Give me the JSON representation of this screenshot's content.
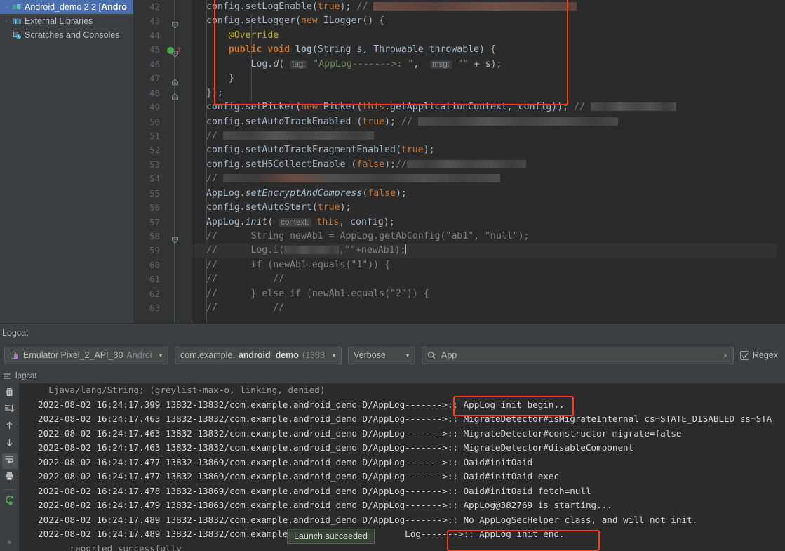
{
  "project_tree": {
    "items": [
      {
        "arrow": "›",
        "icon": "module-icon",
        "label": "Android_demo 2 2 [Andro",
        "bold_from": 18,
        "selected": true
      },
      {
        "arrow": "›",
        "icon": "external-libraries-icon",
        "label": "External Libraries",
        "selected": false
      },
      {
        "arrow": "",
        "icon": "scratches-icon",
        "label": "Scratches and Consoles",
        "selected": false
      }
    ]
  },
  "editor": {
    "lines": [
      {
        "num": "42",
        "fold": "",
        "bp": false,
        "run": false,
        "current": false,
        "tokens": [
          {
            "t": "config.setLogEnable(",
            "c": "typ"
          },
          {
            "t": "true",
            "c": "kw"
          },
          {
            "t": "); ",
            "c": "typ"
          },
          {
            "t": "// ",
            "c": "cmt"
          },
          {
            "t": "REDACT:warm:290",
            "c": "redact"
          }
        ]
      },
      {
        "num": "43",
        "fold": "collapse",
        "bp": false,
        "run": false,
        "current": false,
        "tokens": [
          {
            "t": "config.setLogger(",
            "c": "typ"
          },
          {
            "t": "new ",
            "c": "kw"
          },
          {
            "t": "ILogger() {",
            "c": "typ"
          }
        ]
      },
      {
        "num": "44",
        "fold": "",
        "bp": false,
        "run": false,
        "current": false,
        "tokens": [
          {
            "t": "    @Override",
            "c": "ann"
          }
        ]
      },
      {
        "num": "45",
        "fold": "collapse",
        "bp": true,
        "run": true,
        "current": false,
        "tokens": [
          {
            "t": "    ",
            "c": "typ"
          },
          {
            "t": "public void ",
            "c": "kw-b"
          },
          {
            "t": "log",
            "c": "fn-bold"
          },
          {
            "t": "(String s, Throwable throwable) {",
            "c": "typ"
          }
        ]
      },
      {
        "num": "46",
        "fold": "",
        "bp": false,
        "run": false,
        "current": false,
        "tokens": [
          {
            "t": "        Log.",
            "c": "typ"
          },
          {
            "t": "d",
            "c": "ital"
          },
          {
            "t": "( ",
            "c": "typ"
          },
          {
            "t": "tag:",
            "c": "hint"
          },
          {
            "t": " ",
            "c": "typ"
          },
          {
            "t": "\"AppLog------->: \"",
            "c": "str"
          },
          {
            "t": ",  ",
            "c": "typ"
          },
          {
            "t": "msg:",
            "c": "hint"
          },
          {
            "t": " ",
            "c": "typ"
          },
          {
            "t": "\"\"",
            "c": "str"
          },
          {
            "t": " + s);",
            "c": "typ"
          }
        ]
      },
      {
        "num": "47",
        "fold": "expand",
        "bp": false,
        "run": false,
        "current": false,
        "tokens": [
          {
            "t": "    }",
            "c": "typ"
          }
        ]
      },
      {
        "num": "48",
        "fold": "expand",
        "bp": false,
        "run": false,
        "current": false,
        "tokens": [
          {
            "t": "});",
            "c": "typ"
          }
        ]
      },
      {
        "num": "49",
        "fold": "",
        "bp": false,
        "run": false,
        "current": false,
        "tokens": [
          {
            "t": "config.setPicker(",
            "c": "typ"
          },
          {
            "t": "new ",
            "c": "kw"
          },
          {
            "t": "Picker(",
            "c": "typ"
          },
          {
            "t": "this",
            "c": "kw"
          },
          {
            "t": ".getApplicationContext, config)); ",
            "c": "typ"
          },
          {
            "t": "// ",
            "c": "cmt"
          },
          {
            "t": "REDACT:cool:122",
            "c": "redact"
          }
        ]
      },
      {
        "num": "50",
        "fold": "",
        "bp": false,
        "run": false,
        "current": false,
        "tokens": [
          {
            "t": "config.setAutoTrackEnabled (",
            "c": "typ"
          },
          {
            "t": "true",
            "c": "kw"
          },
          {
            "t": "); ",
            "c": "typ"
          },
          {
            "t": "// ",
            "c": "cmt"
          },
          {
            "t": "REDACT:cool:285",
            "c": "redact"
          }
        ]
      },
      {
        "num": "51",
        "fold": "",
        "bp": false,
        "run": false,
        "current": false,
        "tokens": [
          {
            "t": "// ",
            "c": "cmt"
          },
          {
            "t": "REDACT:cool:215",
            "c": "redact"
          }
        ]
      },
      {
        "num": "52",
        "fold": "",
        "bp": false,
        "run": false,
        "current": false,
        "tokens": [
          {
            "t": "config.setAutoTrackFragmentEnabled(",
            "c": "typ"
          },
          {
            "t": "true",
            "c": "kw"
          },
          {
            "t": ");",
            "c": "typ"
          }
        ]
      },
      {
        "num": "53",
        "fold": "",
        "bp": false,
        "run": false,
        "current": false,
        "tokens": [
          {
            "t": "config.setH5CollectEnable (",
            "c": "typ"
          },
          {
            "t": "false",
            "c": "kw"
          },
          {
            "t": ");",
            "c": "typ"
          },
          {
            "t": "//",
            "c": "cmt"
          },
          {
            "t": "REDACT:cool:170",
            "c": "redact"
          }
        ]
      },
      {
        "num": "54",
        "fold": "",
        "bp": false,
        "run": false,
        "current": false,
        "tokens": [
          {
            "t": "// ",
            "c": "cmt"
          },
          {
            "t": "REDACT:mixed:395",
            "c": "redact"
          }
        ]
      },
      {
        "num": "55",
        "fold": "",
        "bp": false,
        "run": false,
        "current": false,
        "tokens": [
          {
            "t": "AppLog.",
            "c": "typ"
          },
          {
            "t": "setEncryptAndCompress",
            "c": "ital"
          },
          {
            "t": "(",
            "c": "typ"
          },
          {
            "t": "false",
            "c": "kw"
          },
          {
            "t": ");",
            "c": "typ"
          }
        ]
      },
      {
        "num": "56",
        "fold": "",
        "bp": false,
        "run": false,
        "current": false,
        "tokens": [
          {
            "t": "config.setAutoStart(",
            "c": "typ"
          },
          {
            "t": "true",
            "c": "kw"
          },
          {
            "t": ");",
            "c": "typ"
          }
        ]
      },
      {
        "num": "57",
        "fold": "",
        "bp": false,
        "run": false,
        "current": false,
        "tokens": [
          {
            "t": "AppLog.",
            "c": "typ"
          },
          {
            "t": "init",
            "c": "ital"
          },
          {
            "t": "( ",
            "c": "typ"
          },
          {
            "t": "context:",
            "c": "hint"
          },
          {
            "t": " ",
            "c": "typ"
          },
          {
            "t": "this",
            "c": "kw"
          },
          {
            "t": ", config);",
            "c": "typ"
          }
        ]
      },
      {
        "num": "58",
        "fold": "collapse-sm",
        "bp": false,
        "run": false,
        "current": false,
        "tokens": [
          {
            "t": "//      String newAb1 = AppLog.getAbConfig(\"ab1\", \"null\");",
            "c": "cmt"
          }
        ]
      },
      {
        "num": "59",
        "fold": "",
        "bp": false,
        "run": false,
        "current": true,
        "tokens": [
          {
            "t": "//      Log.i(",
            "c": "cmt"
          },
          {
            "t": "REDACT:cool:78",
            "c": "redact"
          },
          {
            "t": ",\"\"+newAb1);",
            "c": "cmt"
          },
          {
            "t": "CARET",
            "c": "caret"
          }
        ]
      },
      {
        "num": "60",
        "fold": "",
        "bp": false,
        "run": false,
        "current": false,
        "tokens": [
          {
            "t": "//      if (newAb1.equals(\"1\")) {",
            "c": "cmt"
          }
        ]
      },
      {
        "num": "61",
        "fold": "",
        "bp": false,
        "run": false,
        "current": false,
        "tokens": [
          {
            "t": "//          //",
            "c": "cmt"
          }
        ]
      },
      {
        "num": "62",
        "fold": "",
        "bp": false,
        "run": false,
        "current": false,
        "tokens": [
          {
            "t": "//      } else if (newAb1.equals(\"2\")) {",
            "c": "cmt"
          }
        ]
      },
      {
        "num": "63",
        "fold": "",
        "bp": false,
        "run": false,
        "current": false,
        "tokens": [
          {
            "t": "//          //",
            "c": "cmt"
          }
        ]
      }
    ]
  },
  "logcat": {
    "panel_title": "Logcat",
    "device": {
      "name": "Emulator Pixel_2_API_30",
      "suffix": "Androi",
      "icon": "device-icon"
    },
    "process": {
      "prefix": "com.example.",
      "bold": "android_demo",
      "pid": "(1383"
    },
    "level": "Verbose",
    "search": {
      "value": "App",
      "icon": "search-icon",
      "clear_icon": "clear-icon"
    },
    "regex_label": "Regex",
    "regex_checked": true,
    "tab_label": "logcat",
    "tab_icon": "logcat-tab-icon",
    "sidebar_buttons": [
      {
        "name": "clear-logcat-button",
        "icon": "trash-icon"
      },
      {
        "name": "scroll-to-end-button",
        "icon": "scroll-end-icon"
      },
      {
        "name": "up-button",
        "icon": "arrow-up-icon"
      },
      {
        "name": "down-button",
        "icon": "arrow-down-icon"
      },
      {
        "name": "soft-wrap-button",
        "icon": "soft-wrap-icon",
        "active": true
      },
      {
        "name": "print-button",
        "icon": "print-icon"
      },
      {
        "name": "restart-button",
        "icon": "restart-icon"
      }
    ],
    "more_label": "»",
    "lines": [
      {
        "faded": true,
        "text": "  Ljava/lang/String; (greylist-max-o, linking, denied)"
      },
      {
        "faded": false,
        "text": "2022-08-02 16:24:17.399 13832-13832/com.example.android_demo D/AppLog------->:: AppLog init begin.."
      },
      {
        "faded": false,
        "text": "2022-08-02 16:24:17.463 13832-13832/com.example.android_demo D/AppLog------->:: MigrateDetector#isMigrateInternal cs=STATE_DISABLED ss=STA"
      },
      {
        "faded": false,
        "text": "2022-08-02 16:24:17.463 13832-13832/com.example.android_demo D/AppLog------->:: MigrateDetector#constructor migrate=false"
      },
      {
        "faded": false,
        "text": "2022-08-02 16:24:17.463 13832-13832/com.example.android_demo D/AppLog------->:: MigrateDetector#disableComponent"
      },
      {
        "faded": false,
        "text": "2022-08-02 16:24:17.477 13832-13869/com.example.android_demo D/AppLog------->:: Oaid#initOaid"
      },
      {
        "faded": false,
        "text": "2022-08-02 16:24:17.477 13832-13869/com.example.android_demo D/AppLog------->:: Oaid#initOaid exec"
      },
      {
        "faded": false,
        "text": "2022-08-02 16:24:17.478 13832-13869/com.example.android_demo D/AppLog------->:: Oaid#initOaid fetch=null"
      },
      {
        "faded": false,
        "text": "2022-08-02 16:24:17.479 13832-13863/com.example.android_demo D/AppLog------->:: AppLog@382769 is starting..."
      },
      {
        "faded": false,
        "text": "2022-08-02 16:24:17.489 13832-13832/com.example.android_demo D/AppLog------->:: No AppLogSecHelper class, and will not init."
      },
      {
        "faded": false,
        "text": "2022-08-02 16:24:17.489 13832-13832/com.example.                     Log------->:: AppLog init end."
      },
      {
        "faded": true,
        "text": "      reported successfully"
      }
    ],
    "launch_tooltip": "Launch succeeded"
  },
  "highlight_color": "#ff3b1f"
}
